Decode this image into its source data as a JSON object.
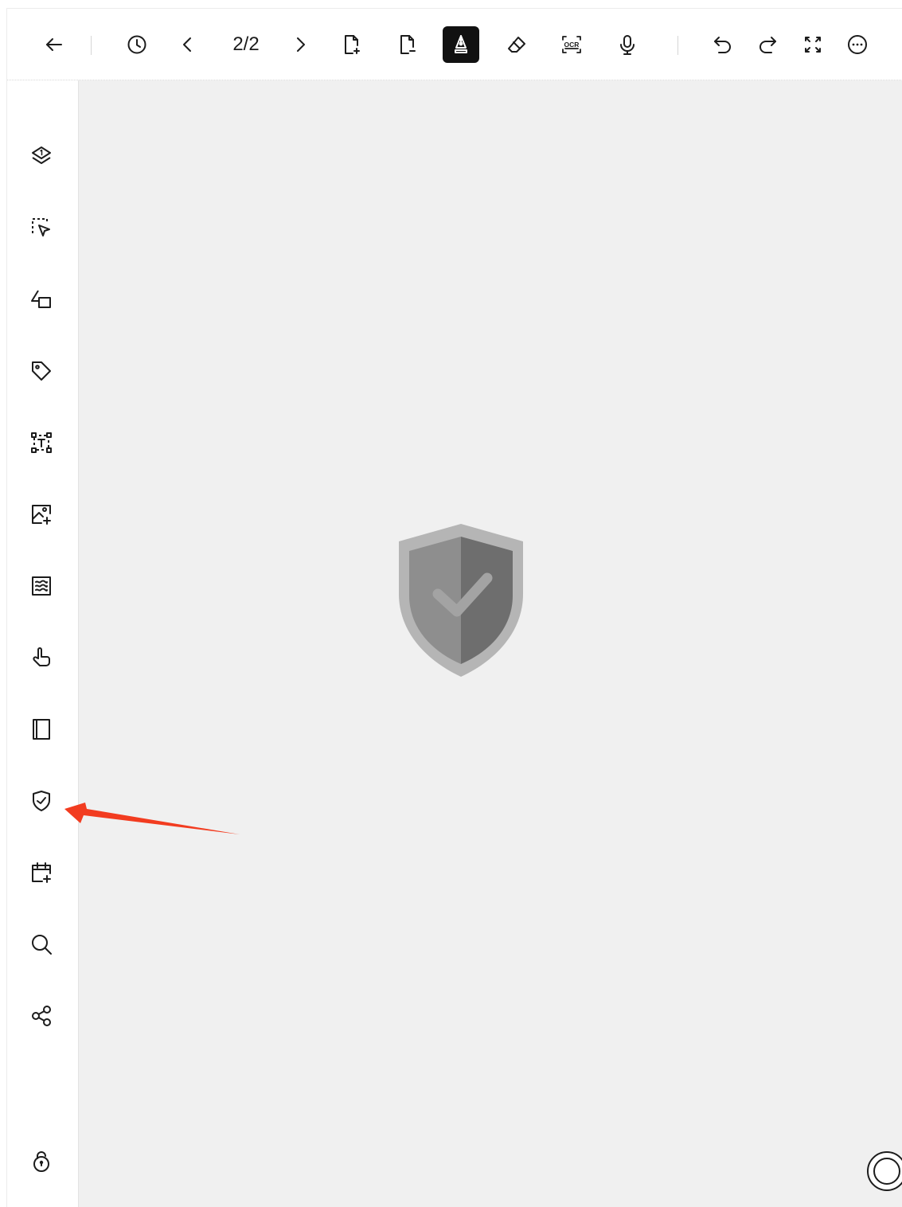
{
  "toolbar": {
    "page_indicator": "2/2",
    "buttons": [
      {
        "name": "back",
        "icon": "arrow-left-icon"
      },
      {
        "name": "history",
        "icon": "clock-icon"
      },
      {
        "name": "previous-page",
        "icon": "chevron-left-icon"
      },
      {
        "name": "next-page",
        "icon": "chevron-right-icon"
      },
      {
        "name": "add-page",
        "icon": "page-add-icon"
      },
      {
        "name": "remove-page",
        "icon": "page-remove-icon"
      },
      {
        "name": "pen-tool",
        "icon": "pen-nib-icon",
        "active": true
      },
      {
        "name": "eraser-tool",
        "icon": "eraser-icon"
      },
      {
        "name": "ocr-tool",
        "icon": "ocr-icon",
        "label": "OCR"
      },
      {
        "name": "voice-record",
        "icon": "microphone-icon"
      },
      {
        "name": "undo",
        "icon": "undo-icon"
      },
      {
        "name": "redo",
        "icon": "redo-icon"
      },
      {
        "name": "fullscreen",
        "icon": "expand-icon"
      },
      {
        "name": "more",
        "icon": "more-dots-icon"
      }
    ]
  },
  "sidebar": {
    "items": [
      {
        "name": "layers",
        "icon": "layers-icon"
      },
      {
        "name": "lasso-select",
        "icon": "lasso-select-icon"
      },
      {
        "name": "shapes",
        "icon": "shapes-icon"
      },
      {
        "name": "tag",
        "icon": "tag-icon"
      },
      {
        "name": "text-box",
        "icon": "text-box-icon"
      },
      {
        "name": "insert-image",
        "icon": "image-add-icon"
      },
      {
        "name": "template",
        "icon": "template-icon"
      },
      {
        "name": "hand",
        "icon": "hand-pointer-icon"
      },
      {
        "name": "notebook",
        "icon": "notebook-icon"
      },
      {
        "name": "shield-check",
        "icon": "shield-check-icon"
      },
      {
        "name": "add-to-calendar",
        "icon": "calendar-add-icon"
      },
      {
        "name": "search",
        "icon": "search-icon"
      },
      {
        "name": "share",
        "icon": "share-icon"
      },
      {
        "name": "lock",
        "icon": "lock-icon"
      }
    ]
  },
  "canvas": {
    "illustration": "shield-check-illustration"
  },
  "colors": {
    "accent_active": "#111111",
    "canvas_bg": "#f0f0f0",
    "annotation_arrow": "#f23c20",
    "shield_light": "#b5b5b5",
    "shield_mid": "#8e8e8e",
    "shield_dark": "#6e6e6e"
  }
}
